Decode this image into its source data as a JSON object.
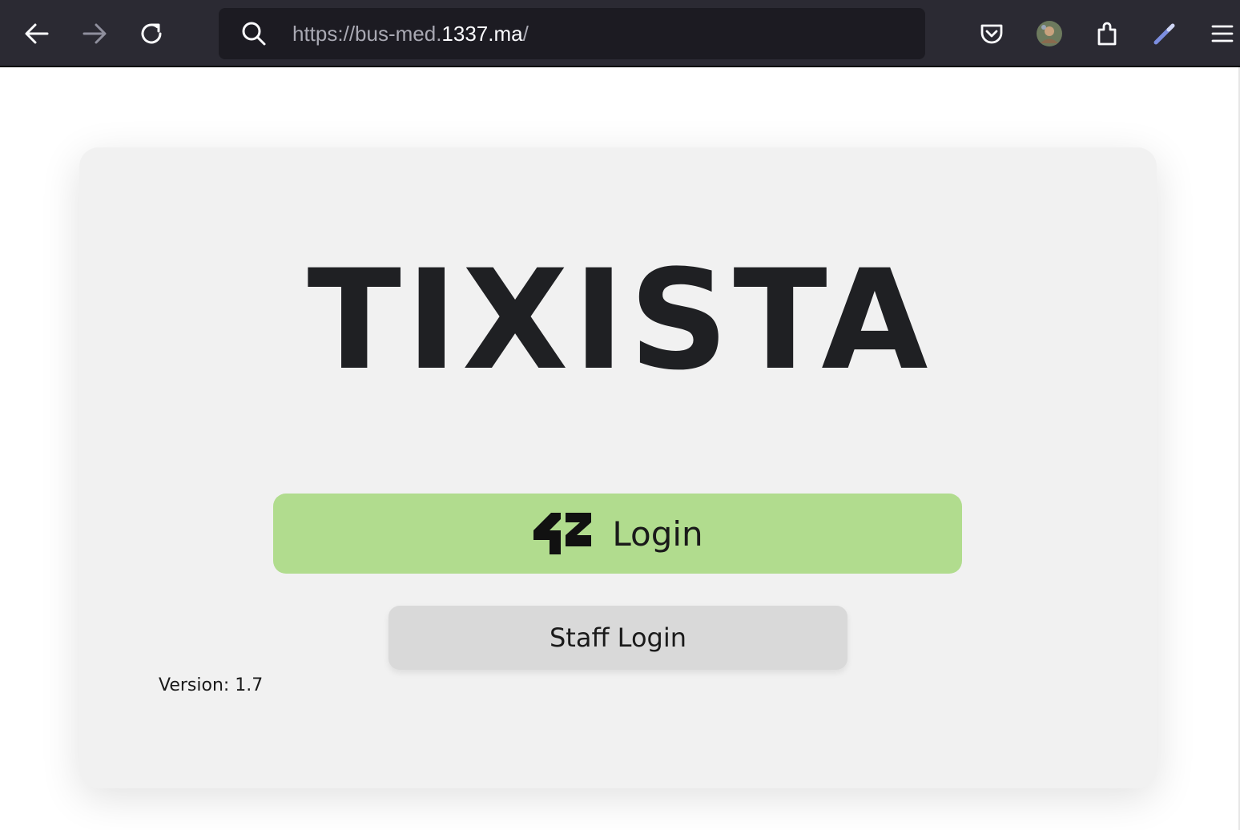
{
  "browser": {
    "url_prefix": "https://bus-med.",
    "url_domain": "1337.ma",
    "url_suffix": "/",
    "icons": {
      "back": "back-arrow-icon",
      "forward": "forward-arrow-icon",
      "reload": "reload-icon",
      "search": "search-icon",
      "pocket": "pocket-icon",
      "account": "account-avatar-icon",
      "extensions": "extensions-icon",
      "eyedropper": "eyedropper-icon",
      "menu": "hamburger-menu-icon"
    },
    "colors": {
      "toolbar": "#2b2a33",
      "urlbar": "#1c1b22"
    }
  },
  "page": {
    "brand": "TIXISTA",
    "login_button": {
      "logo": "42",
      "label": "Login",
      "color": "#b1dc8e"
    },
    "staff_button": {
      "label": "Staff Login",
      "color": "#d9d9d9"
    },
    "version": "Version: 1.7"
  }
}
